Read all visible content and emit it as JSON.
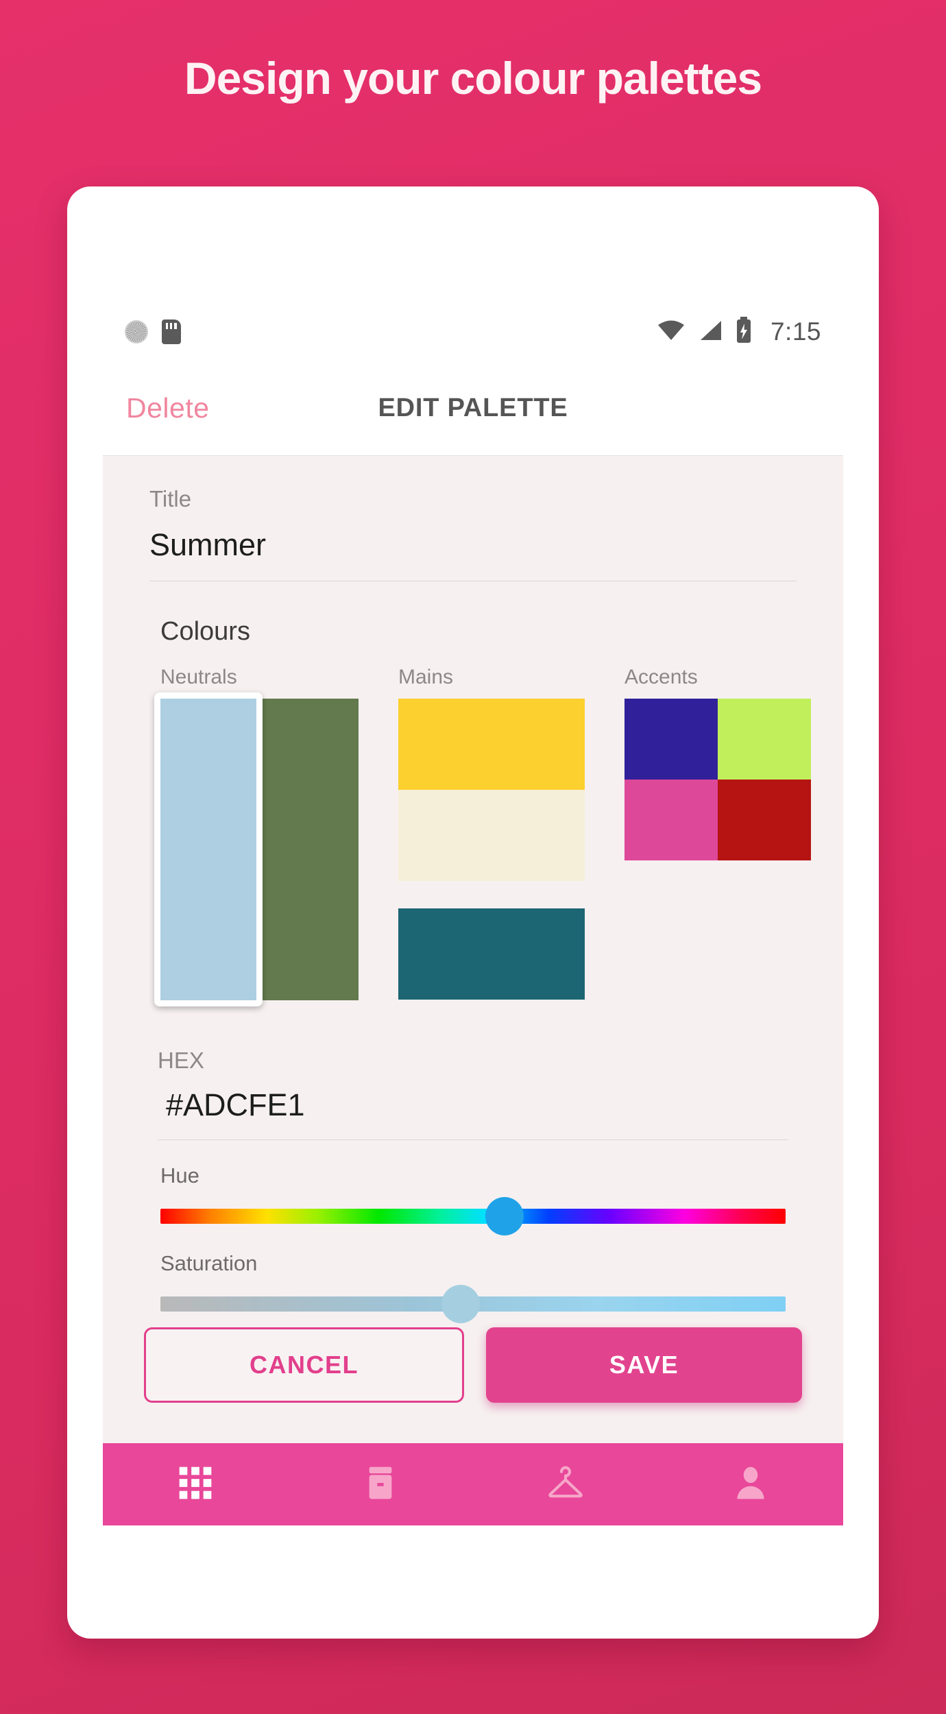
{
  "promo": {
    "headline": "Design your colour palettes",
    "background_from": "#E5306A",
    "background_to": "#CC2A58"
  },
  "statusbar": {
    "time": "7:15",
    "icons_left": [
      "spinner-icon",
      "sdcard-icon"
    ],
    "icons_right": [
      "wifi-icon",
      "signal-icon",
      "battery-charging-icon"
    ]
  },
  "appbar": {
    "delete_label": "Delete",
    "title": "EDIT PALETTE",
    "delete_color": "#F0869F",
    "title_color": "#555555"
  },
  "form": {
    "title_label": "Title",
    "title_value": "Summer",
    "hex_label": "HEX",
    "hex_value": "#ADCFE1"
  },
  "colours": {
    "section_label": "Colours",
    "groups": [
      {
        "label": "Neutrals",
        "swatches": [
          "#ADCFE1",
          "#627A4D"
        ],
        "selected_index": 0
      },
      {
        "label": "Mains",
        "swatches": [
          "#FCD02F",
          "#F5EFD9",
          "#1C6573"
        ],
        "selected_index": -1
      },
      {
        "label": "Accents",
        "swatches": [
          "#30219A",
          "#C1EF5C",
          "#DE4899",
          "#B61313"
        ],
        "selected_index": -1
      }
    ]
  },
  "sliders": [
    {
      "label": "Hue",
      "value_pct": 55,
      "thumb_color": "#1FA2E8"
    },
    {
      "label": "Saturation",
      "value_pct": 48,
      "thumb_color": "#A5CFE0"
    }
  ],
  "buttons": {
    "cancel_label": "CANCEL",
    "save_label": "SAVE",
    "accent_color": "#E2438F"
  },
  "bottom_nav": {
    "background": "#E8479A",
    "items": [
      {
        "icon": "grid-icon",
        "active": true
      },
      {
        "icon": "archive-icon",
        "active": false
      },
      {
        "icon": "hanger-icon",
        "active": false
      },
      {
        "icon": "person-icon",
        "active": false
      }
    ]
  }
}
